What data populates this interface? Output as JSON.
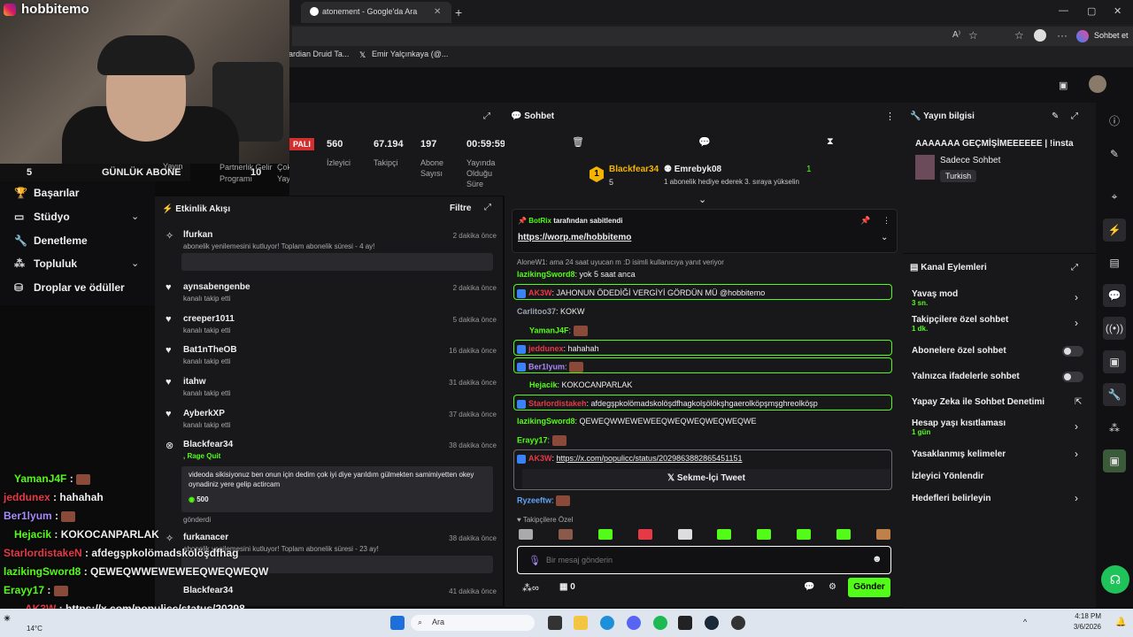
{
  "browser": {
    "tab_title": "atonement - Google'da Ara",
    "bookmark1": "ardian Druid Ta...",
    "bookmark2": "Emir Yalçınkaya (@...",
    "chat_label": "Sohbet et"
  },
  "webcam": {
    "streamer": "hobbitemo"
  },
  "subgoal": {
    "count": "5",
    "label": "GÜNLÜK ABONE",
    "target": "10"
  },
  "nav": {
    "items": [
      "Başarılar",
      "Stüdyo",
      "Denetleme",
      "Topluluk",
      "Droplar ve ödüller"
    ],
    "partial": [
      "Yayın",
      "Partnerlik Gelir Programı",
      "Çoklu Yayın"
    ]
  },
  "stats": {
    "badge": "PALI",
    "viewers": "560",
    "viewers_lbl": "İzleyici",
    "followers": "67.194",
    "followers_lbl": "Takipçi",
    "subs": "197",
    "subs_lbl": "Abone Sayısı",
    "uptime": "00:59:59",
    "uptime_lbl": "Yayında Olduğu Süre"
  },
  "activity": {
    "title": "Etkinlik Akışı",
    "filter": "Filtre",
    "items": [
      {
        "name": "lfurkan",
        "sub": "abonelik yenilemesini kutluyor! Toplam abonelik süresi - 4 ay!",
        "time": "2 dakika önce"
      },
      {
        "name": "aynsabengenbe",
        "sub": "kanalı takip etti",
        "time": "2 dakika önce"
      },
      {
        "name": "creeper1011",
        "sub": "kanalı takip etti",
        "time": "5 dakika önce"
      },
      {
        "name": "Bat1nTheOB",
        "sub": "kanalı takip etti",
        "time": "16 dakika önce"
      },
      {
        "name": "itahw",
        "sub": "kanalı takip etti",
        "time": "31 dakika önce"
      },
      {
        "name": "AyberkXP",
        "sub": "kanalı takip etti",
        "time": "37 dakika önce"
      },
      {
        "name": "Blackfear34",
        "sub": ", Rage Quit",
        "time": "38 dakika önce"
      },
      {
        "name": "furkanacer",
        "sub": "abonelik yenilemesini kutluyor! Toplam abonelik süresi - 23 ay!",
        "time": "38 dakika önce"
      },
      {
        "name": "Blackfear34",
        "sub": "",
        "time": "41 dakika önce"
      }
    ],
    "rage_text": "videoda sikisiyonuz ben onun için dedim çok iyi diye yarıldım gülmekten samimiyetten okey oynadiniz yere gelip actircam",
    "rage_amount": "500",
    "rage_sent": "gönderdi"
  },
  "chat": {
    "title": "Sohbet",
    "top_gifter": "Blackfear34",
    "top_gifter_count": "5",
    "gifter2": "Emrebyk08",
    "gifter2_count": "1",
    "gift_note": "1 abonelik hediye ederek 3. sıraya yükselin",
    "rank": "1",
    "pinned_by": "BotRix",
    "pinned_suffix": "tarafından sabitlendi",
    "pinned_link": "https://worp.me/hobbitemo",
    "reply_note": "AloneW1: ama 24 saat uyucan m :D isimli kullanıcıya yanıt veriyor",
    "messages": [
      {
        "user": "lazikingSword8",
        "text": "yok 5 saat anca",
        "color": "#53fc18"
      },
      {
        "user": "AK3W",
        "text": "JAHONUN ÖDEDİĞİ VERGİYİ GÖRDÜN MÜ @hobbitemo",
        "color": "#e63946"
      },
      {
        "user": "Carlitoo37",
        "text": "KOKW",
        "color": "#9ca3af"
      },
      {
        "user": "YamanJ4F",
        "text": "",
        "color": "#53fc18"
      },
      {
        "user": "jeddunex",
        "text": "hahahah",
        "color": "#e63946"
      },
      {
        "user": "Ber1lyum",
        "text": "",
        "color": "#a78bfa"
      },
      {
        "user": "Hejacik",
        "text": "KOKOCANPARLAK",
        "color": "#53fc18"
      },
      {
        "user": "Starlordistakeh",
        "text": "afdegşpkolömadskolöşdfhagkolşölökşhgaerolköpşmşghreolköşp",
        "color": "#e63946"
      },
      {
        "user": "lazikingSword8",
        "text": "QEWEQWWEWEWEEQWEQWEQWEQWEQWE",
        "color": "#53fc18"
      },
      {
        "user": "Erayy17",
        "text": "",
        "color": "#53fc18"
      },
      {
        "user": "AK3W",
        "text": "https://x.com/populicc/status/2029863882865451151",
        "color": "#e63946"
      },
      {
        "user": "Ryzeeftw",
        "text": "",
        "color": "#60a5fa"
      }
    ],
    "tweet_btn": "Sekme-İçi Tweet",
    "followers_only": "Takipçilere Özel",
    "placeholder": "Bir mesaj gönderin",
    "points": "0",
    "send": "Gönder"
  },
  "info": {
    "title": "Yayın bilgisi",
    "stream_title": "AAAAAAA GEÇMİŞİMEEEEEE | !insta",
    "category": "Sadece Sohbet",
    "tag": "Turkish"
  },
  "actions": {
    "title": "Kanal Eylemleri",
    "slow": "Yavaş mod",
    "slow_v": "3 sn.",
    "followers": "Takipçilere özel sohbet",
    "followers_v": "1 dk.",
    "subs": "Abonelere özel sohbet",
    "emotes": "Yalnızca ifadelerle sohbet",
    "ai": "Yapay Zeka ile Sohbet Denetimi",
    "age": "Hesap yaşı kısıtlaması",
    "age_v": "1 gün",
    "banned": "Yasaklanmış kelimeler",
    "redirect": "İzleyici Yönlendir",
    "target": "Hedefleri belirleyin"
  },
  "overlay": {
    "lines": [
      {
        "user": "YamanJ4F",
        "text": "",
        "color": "#53fc18"
      },
      {
        "user": "jeddunex",
        "text": "hahahah",
        "color": "#e63946"
      },
      {
        "user": "Ber1lyum",
        "text": "",
        "color": "#a78bfa"
      },
      {
        "user": "Hejacik",
        "text": "KOKOCANPARLAK",
        "color": "#53fc18"
      },
      {
        "user": "StarlordistakeN",
        "text": "afdegşpkolömadskolöşdfhag",
        "color": "#e63946"
      },
      {
        "user": "lazikingSword8",
        "text": "QEWEQWWEWEWEEQWEQWEQW",
        "color": "#53fc18"
      },
      {
        "user": "Erayy17",
        "text": "",
        "color": "#53fc18"
      },
      {
        "user": "AK3W",
        "text": "https://x.com/populicc/status/20298",
        "color": "#e63946"
      }
    ]
  },
  "taskbar": {
    "weather": "14°C",
    "search": "Ara",
    "time": "4:18 PM",
    "date": "3/6/2026"
  }
}
